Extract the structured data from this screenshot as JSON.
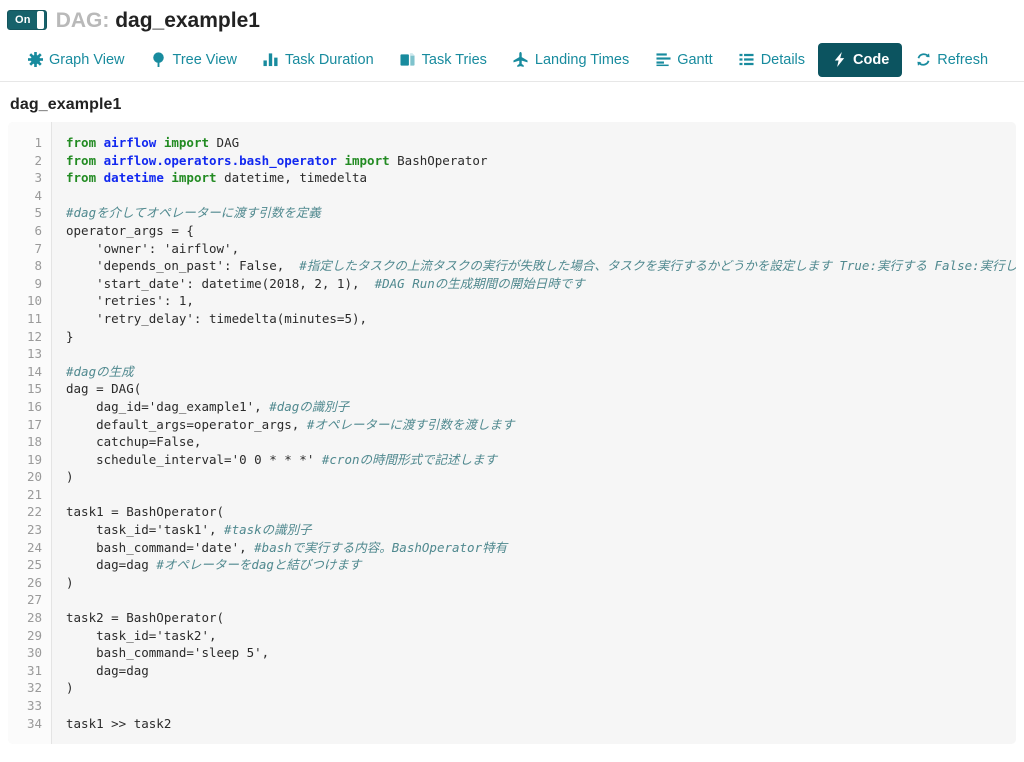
{
  "header": {
    "toggle": {
      "label": "On",
      "name": "dag-on-off-toggle"
    },
    "prefix": "DAG: ",
    "dag_name": "dag_example1"
  },
  "tabs": [
    {
      "label": "Graph View",
      "icon": "asterisk-icon",
      "active": false
    },
    {
      "label": "Tree View",
      "icon": "tree-icon",
      "active": false
    },
    {
      "label": "Task Duration",
      "icon": "bar-chart-icon",
      "active": false
    },
    {
      "label": "Task Tries",
      "icon": "copy-files-icon",
      "active": false
    },
    {
      "label": "Landing Times",
      "icon": "airplane-icon",
      "active": false
    },
    {
      "label": "Gantt",
      "icon": "align-left-icon",
      "active": false
    },
    {
      "label": "Details",
      "icon": "list-icon",
      "active": false
    },
    {
      "label": "Code",
      "icon": "lightning-icon",
      "active": true
    },
    {
      "label": "Refresh",
      "icon": "refresh-icon",
      "active": false
    }
  ],
  "code_section": {
    "heading": "dag_example1",
    "line_numbers": [
      1,
      2,
      3,
      4,
      5,
      6,
      7,
      8,
      9,
      10,
      11,
      12,
      13,
      14,
      15,
      16,
      17,
      18,
      19,
      20,
      21,
      22,
      23,
      24,
      25,
      26,
      27,
      28,
      29,
      30,
      31,
      32,
      33,
      34
    ],
    "lines": [
      [
        {
          "t": "from ",
          "c": "kw"
        },
        {
          "t": "airflow",
          "c": "mod"
        },
        {
          "t": " import ",
          "c": "kw"
        },
        {
          "t": "DAG",
          "c": ""
        }
      ],
      [
        {
          "t": "from ",
          "c": "kw"
        },
        {
          "t": "airflow.operators.bash_operator",
          "c": "mod"
        },
        {
          "t": " import ",
          "c": "kw"
        },
        {
          "t": "BashOperator",
          "c": ""
        }
      ],
      [
        {
          "t": "from ",
          "c": "kw"
        },
        {
          "t": "datetime",
          "c": "mod"
        },
        {
          "t": " import ",
          "c": "kw"
        },
        {
          "t": "datetime, timedelta",
          "c": ""
        }
      ],
      [],
      [
        {
          "t": "#dagを介してオペレーターに渡す引数を定義",
          "c": "cm"
        }
      ],
      [
        {
          "t": "operator_args = {",
          "c": ""
        }
      ],
      [
        {
          "t": "    'owner': 'airflow',",
          "c": ""
        }
      ],
      [
        {
          "t": "    'depends_on_past': False,  ",
          "c": ""
        },
        {
          "t": "#指定したタスクの上流タスクの実行が失敗した場合、タスクを実行するかどうかを設定します True:実行する False:実行しない",
          "c": "cm"
        }
      ],
      [
        {
          "t": "    'start_date': datetime(2018, 2, 1),  ",
          "c": ""
        },
        {
          "t": "#DAG Runの生成期間の開始日時です",
          "c": "cm"
        }
      ],
      [
        {
          "t": "    'retries': 1,",
          "c": ""
        }
      ],
      [
        {
          "t": "    'retry_delay': timedelta(minutes=5),",
          "c": ""
        }
      ],
      [
        {
          "t": "}",
          "c": ""
        }
      ],
      [],
      [
        {
          "t": "#dagの生成",
          "c": "cm"
        }
      ],
      [
        {
          "t": "dag = DAG(",
          "c": ""
        }
      ],
      [
        {
          "t": "    dag_id='dag_example1', ",
          "c": ""
        },
        {
          "t": "#dagの識別子",
          "c": "cm"
        }
      ],
      [
        {
          "t": "    default_args=operator_args, ",
          "c": ""
        },
        {
          "t": "#オペレーターに渡す引数を渡します",
          "c": "cm"
        }
      ],
      [
        {
          "t": "    catchup=False,",
          "c": ""
        }
      ],
      [
        {
          "t": "    schedule_interval='0 0 * * *' ",
          "c": ""
        },
        {
          "t": "#cronの時間形式で記述します",
          "c": "cm"
        }
      ],
      [
        {
          "t": ")",
          "c": ""
        }
      ],
      [],
      [
        {
          "t": "task1 = BashOperator(",
          "c": ""
        }
      ],
      [
        {
          "t": "    task_id='task1', ",
          "c": ""
        },
        {
          "t": "#taskの識別子",
          "c": "cm"
        }
      ],
      [
        {
          "t": "    bash_command='date', ",
          "c": ""
        },
        {
          "t": "#bashで実行する内容。BashOperator特有",
          "c": "cm"
        }
      ],
      [
        {
          "t": "    dag=dag ",
          "c": ""
        },
        {
          "t": "#オペレーターをdagと結びつけます",
          "c": "cm"
        }
      ],
      [
        {
          "t": ")",
          "c": ""
        }
      ],
      [],
      [
        {
          "t": "task2 = BashOperator(",
          "c": ""
        }
      ],
      [
        {
          "t": "    task_id='task2',",
          "c": ""
        }
      ],
      [
        {
          "t": "    bash_command='sleep 5',",
          "c": ""
        }
      ],
      [
        {
          "t": "    dag=dag",
          "c": ""
        }
      ],
      [
        {
          "t": ")",
          "c": ""
        }
      ],
      [],
      [
        {
          "t": "task1 >> task2",
          "c": ""
        }
      ]
    ]
  },
  "colors": {
    "accent_teal": "#188b9e",
    "active_tab_bg": "#0c5460",
    "toggle_bg": "#17626b",
    "keyword_green": "#228B22",
    "module_blue": "#1128f0",
    "comment_teal": "#50898f",
    "code_bg": "#f6f6f6"
  }
}
